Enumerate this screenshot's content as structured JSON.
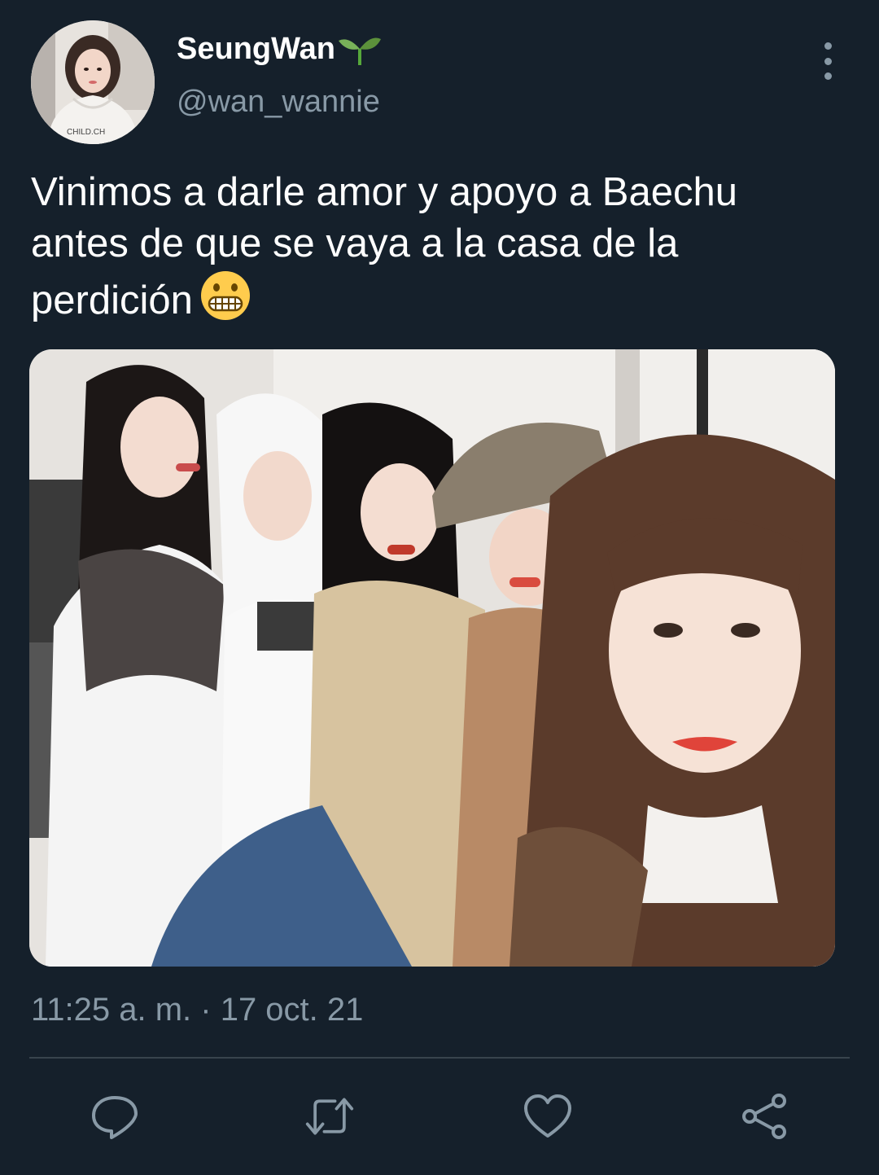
{
  "user": {
    "display_name": "SeungWan",
    "name_emoji": "seedling-icon",
    "handle": "@wan_wannie",
    "avatar_text": "CHILD.CH"
  },
  "tweet": {
    "text_lines": [
      "Vinimos a darle amor y apoyo a Baechu",
      "antes de que se vaya a la casa de la",
      "perdición"
    ],
    "text_emoji": "grimacing-face-icon",
    "timestamp": "11:25 a. m. · 17 oct. 21"
  },
  "actions": [
    {
      "name": "reply",
      "icon": "reply-icon"
    },
    {
      "name": "retweet",
      "icon": "retweet-icon"
    },
    {
      "name": "like",
      "icon": "heart-icon"
    },
    {
      "name": "share",
      "icon": "share-icon"
    }
  ],
  "colors": {
    "background": "#15202b",
    "secondary_text": "#8899a6",
    "divider": "#38444d",
    "primary_text": "#ffffff"
  }
}
